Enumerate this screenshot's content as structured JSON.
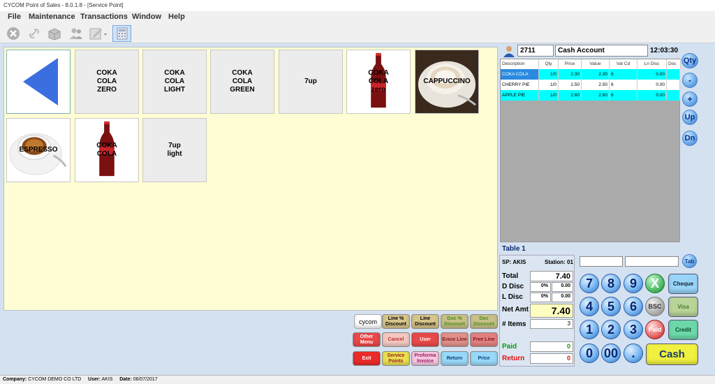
{
  "window": {
    "title": "CYCOM Point of Sales - 8.0.1.8 - [Service Point]"
  },
  "menu": [
    "File",
    "Maintenance",
    "Transactions",
    "Window",
    "Help"
  ],
  "toolbar": {
    "icons": [
      "cancel-icon",
      "link-icon",
      "box-icon",
      "users-icon",
      "edit-icon",
      "calculator-icon"
    ]
  },
  "products": [
    "COKA\nCOLA\nZERO",
    "COKA\nCOLA\nLIGHT",
    "COKA\nCOLA\nGREEN",
    "7up",
    "COKA\nCOLA\nzero",
    "CAPPUCCINO",
    "ESPRESSO",
    "COKA\nCOLA",
    "7up\nlight"
  ],
  "customer": {
    "code": "2711",
    "name": "Cash Account",
    "time": "12:03:30"
  },
  "grid": {
    "headers": [
      "Description",
      "Qty",
      "Price",
      "Value",
      "Vat Cd",
      "Ln Disc",
      "Doc"
    ],
    "rows": [
      [
        "COKA COLA",
        "1/0",
        "2.30",
        "2.30",
        "6",
        "0.00",
        ""
      ],
      [
        "CHERRY PIE",
        "1/0",
        "2.50",
        "2.50",
        "6",
        "0.00",
        ""
      ],
      [
        "APPLE PIE",
        "1/0",
        "2.60",
        "2.60",
        "6",
        "0.00",
        ""
      ]
    ]
  },
  "nav": {
    "qty": "Qty",
    "minus": "-",
    "plus": "+",
    "up": "Up",
    "dn": "Dn"
  },
  "table": {
    "label": "Table 1"
  },
  "totals": {
    "sp": "SP: AKIS",
    "station": "Station: 01",
    "total_label": "Total",
    "total": "7.40",
    "ddisc_label": "D Disc",
    "ddisc_pct": "0%",
    "ddisc_val": "0.00",
    "ldisc_label": "L Disc",
    "ldisc_pct": "0%",
    "ldisc_val": "0.00",
    "net_label": "Net Amt",
    "net": "7.40",
    "items_label": "# Items",
    "items": "3",
    "paid_label": "Paid",
    "paid": "0",
    "return_label": "Return",
    "return": "0"
  },
  "keypad": {
    "tab": "Tab",
    "keys": [
      "7",
      "8",
      "9",
      "X",
      "4",
      "5",
      "6",
      "BSC",
      "1",
      "2",
      "3",
      "Paid",
      "0",
      "00",
      "."
    ],
    "cheque": "Cheque",
    "visa": "Visa",
    "credit": "Credit",
    "cash": "Cash"
  },
  "actions": {
    "logo": "cycom",
    "ln_pct": "Line % Discount",
    "ln_disc": "Line Discount",
    "doc_pct": "Doc % Discount",
    "doc_disc": "Doc Discount",
    "other": "Other Menu",
    "cancel": "Cancel",
    "user": "User",
    "erase": "Erase Line",
    "free": "Free Line",
    "exit": "Exit",
    "service": "Service Points",
    "proforma": "Proforma Invoice",
    "return": "Return",
    "price": "Price"
  },
  "status": {
    "company_label": "Company:",
    "company": "CYCOM DEMO CO LTD",
    "user_label": "User:",
    "user": "AKIS",
    "date_label": "Date:",
    "date": "06/07/2017"
  },
  "colors": {
    "accent": "#00ffff",
    "cash": "#f0f040",
    "panel": "#fefdd3"
  }
}
